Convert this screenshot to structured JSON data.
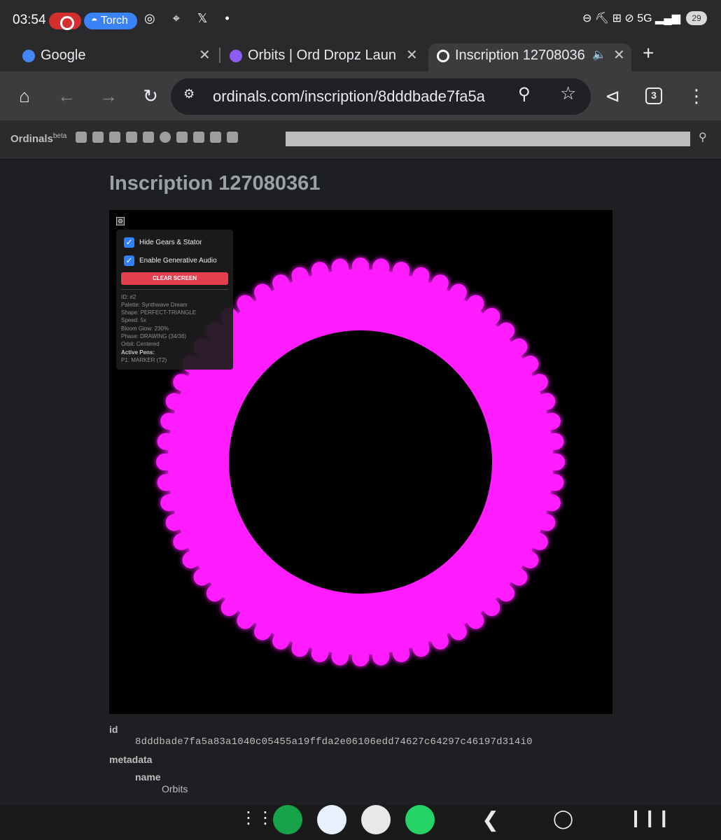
{
  "status": {
    "time": "03:54",
    "torch": "Torch",
    "battery": "29",
    "icons_left": "◎ ⌖ 𝕏 •",
    "icons_right": "⊖ ⛏ ⊞ ⊘ 5G ▂▄▆"
  },
  "tabs": [
    {
      "label": "Google",
      "color": "#4285f4"
    },
    {
      "label": "Orbits | Ord Dropz Laun",
      "color": "#8b5cf6"
    },
    {
      "label": "Inscription 12708036",
      "color": "#ffffff"
    }
  ],
  "toolbar": {
    "url": "ordinals.com/inscription/8dddbade7fa5a",
    "tab_count": "3"
  },
  "site": {
    "logo": "Ordinals",
    "logo_sup": "beta"
  },
  "page": {
    "title": "Inscription 127080361"
  },
  "panel": {
    "hide_gears": "Hide Gears & Stator",
    "enable_audio": "Enable Generative Audio",
    "clear": "CLEAR SCREEN",
    "info": [
      "ID: #2",
      "Palette: Synthwave Dream",
      "Shape: PERFECT-TRIANGLE",
      "Speed: 5x",
      "Bloom Glow: 230%",
      "Phase: DRAWING (34/36)",
      "Orbit: Centered"
    ],
    "active_pens_label": "Active Pens:",
    "pen": "P1: MARKER (T2)"
  },
  "ring": {
    "color": "#ff1aff",
    "glow": "#ff3cd2",
    "teeth": 60
  },
  "fields": {
    "id_label": "id",
    "id_value": "8dddbade7fa5a83a1040c05455a19ffda2e06106edd74627c64297c46197d314i0",
    "metadata_label": "metadata",
    "name_label": "name",
    "name_value": "Orbits"
  },
  "dock": [
    {
      "name": "apps",
      "color": "#1a1a1a"
    },
    {
      "name": "phone",
      "color": "#16a34a"
    },
    {
      "name": "messages",
      "color": "#e8f0fe"
    },
    {
      "name": "chrome",
      "color": "#e8e8e8"
    },
    {
      "name": "whatsapp",
      "color": "#25d366"
    }
  ]
}
